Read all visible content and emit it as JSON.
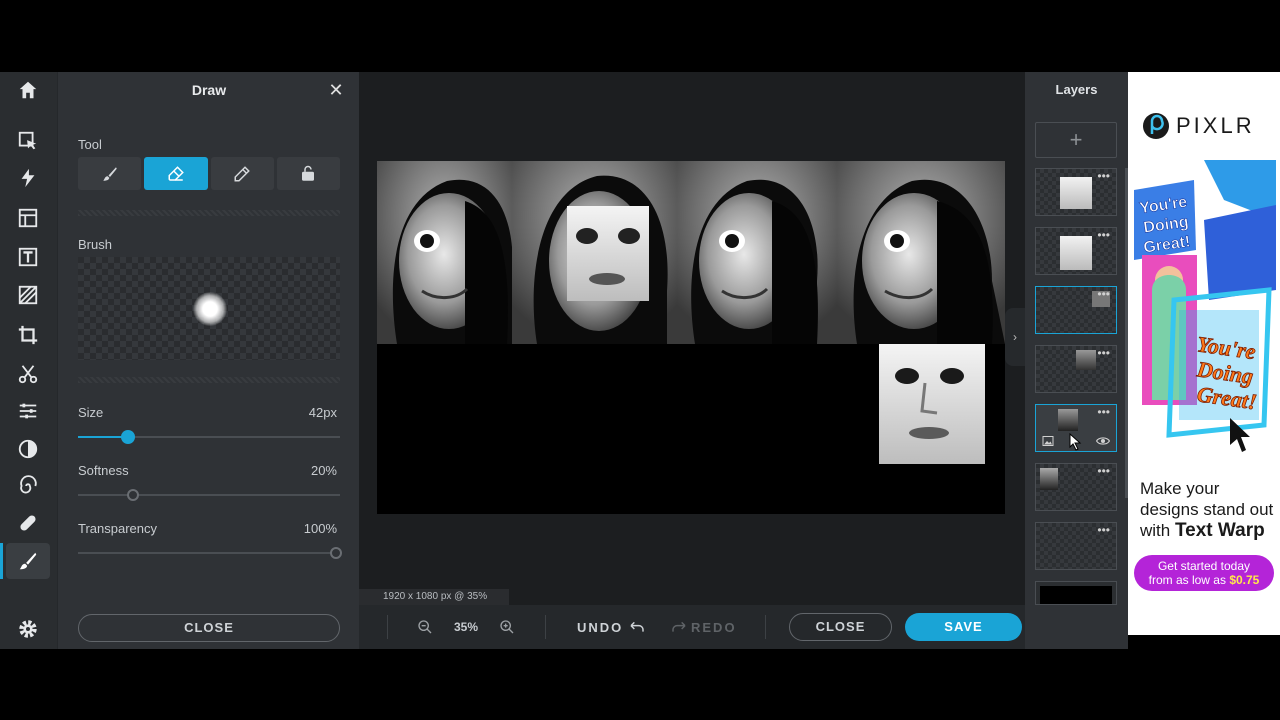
{
  "left_rail": {
    "icons": [
      "home-icon",
      "select-icon",
      "lightning-icon",
      "layout-icon",
      "text-icon",
      "pattern-icon",
      "crop-icon",
      "cut-icon",
      "adjust-icon",
      "contrast-icon",
      "liquify-icon",
      "heal-icon",
      "draw-icon",
      "settings-icon"
    ],
    "active": "draw-icon"
  },
  "draw_panel": {
    "title": "Draw",
    "tool_label": "Tool",
    "tools": [
      "brush-icon",
      "eraser-icon",
      "pencil-icon",
      "fill-icon"
    ],
    "selected_tool": "eraser-icon",
    "brush_label": "Brush",
    "size_label": "Size",
    "size_value": "42px",
    "size_fraction": 0.18,
    "softness_label": "Softness",
    "softness_value": "20%",
    "softness_fraction": 0.2,
    "transparency_label": "Transparency",
    "transparency_value": "100%",
    "transparency_fraction": 1.0,
    "close_label": "CLOSE"
  },
  "canvas": {
    "size_info": "1920 x 1080 px @ 35%"
  },
  "bottom_bar": {
    "zoom_value": "35%",
    "undo_label": "UNDO",
    "redo_label": "REDO",
    "close_label": "CLOSE",
    "save_label": "SAVE"
  },
  "layers_panel": {
    "title": "Layers",
    "add_label": "+"
  },
  "ad": {
    "brand": "PIXLR",
    "tagline_1": "Make your designs stand out with",
    "tagline_bold": "Text Warp",
    "cta_1": "Get started today",
    "cta_2": "from as low as",
    "cta_price": "$0.75",
    "art_text_1": "You're",
    "art_text_2": "Doing",
    "art_text_3": "Great!"
  },
  "colors": {
    "accent": "#1aa4d6",
    "panel": "#2f3236",
    "stage": "#1c1e20",
    "ad_cta": "#b424d8"
  }
}
